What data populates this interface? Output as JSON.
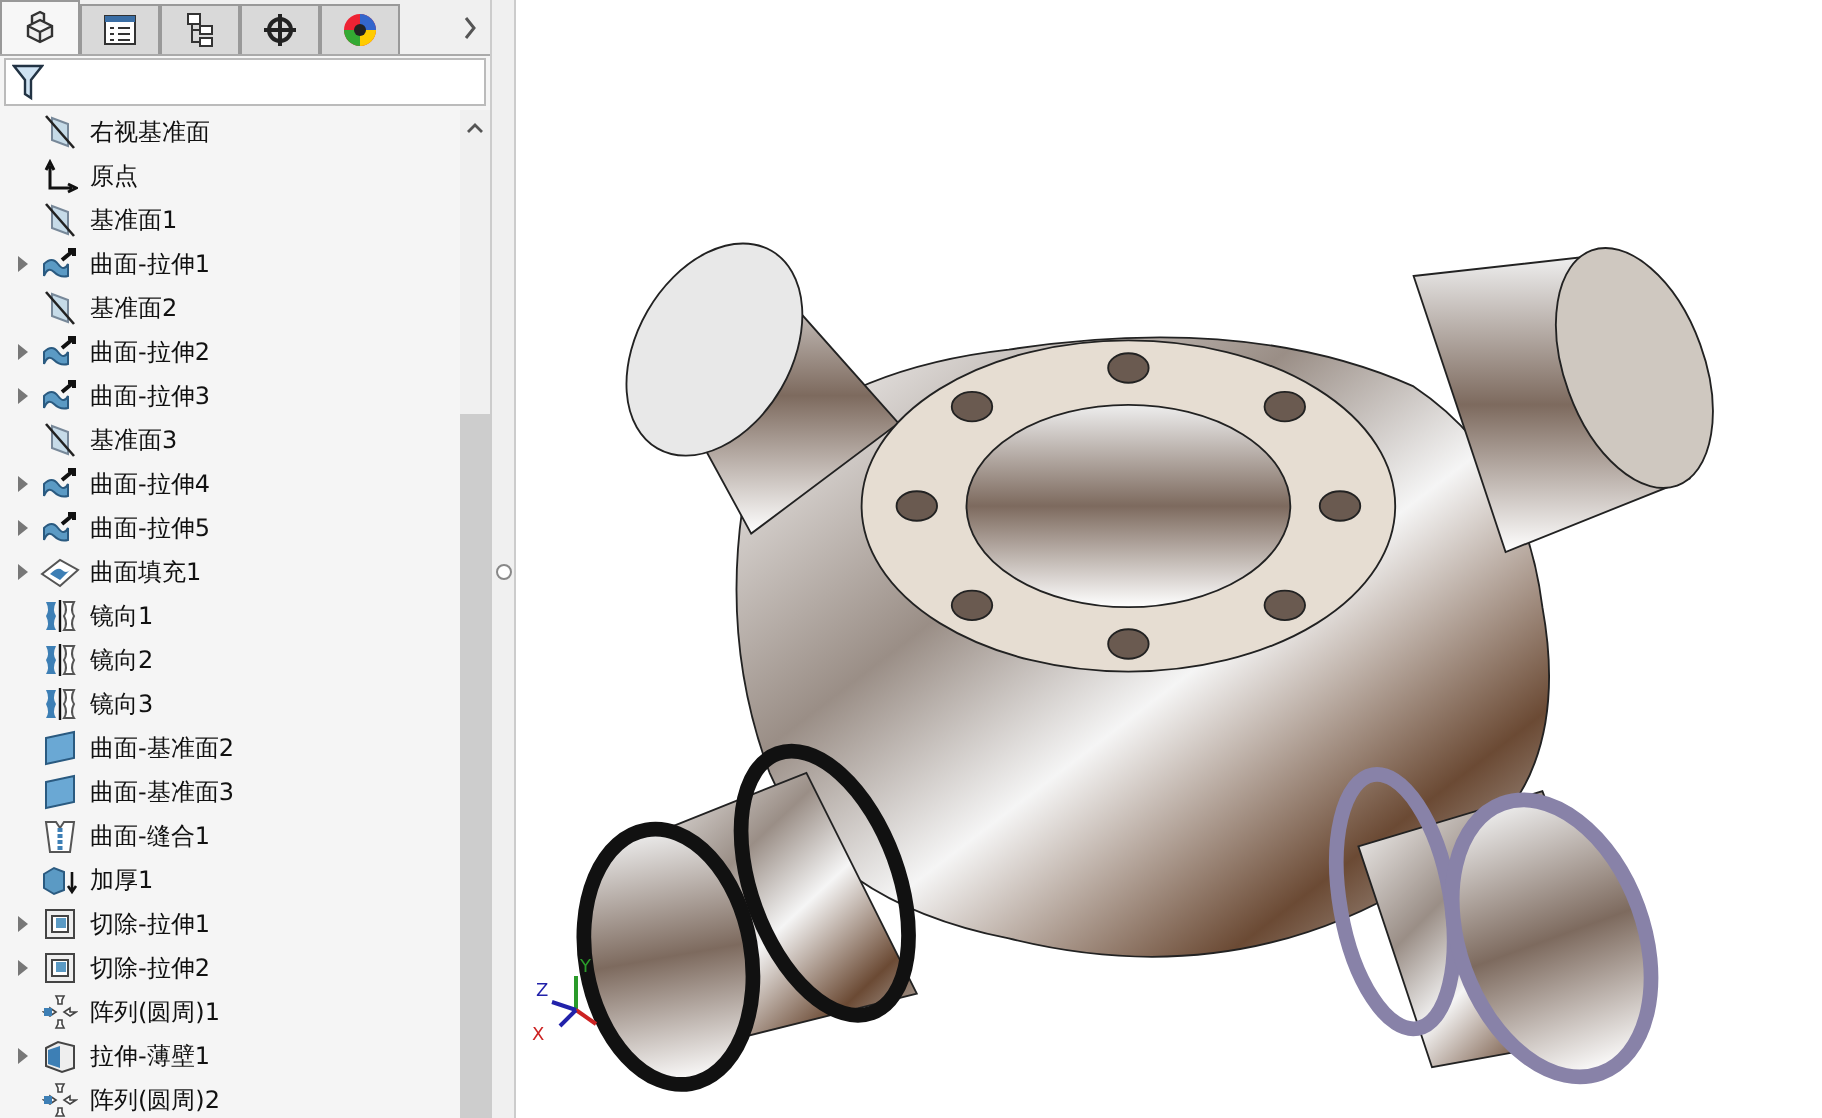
{
  "tabs": [
    {
      "kind": "part",
      "selected": true
    },
    {
      "kind": "property",
      "selected": false
    },
    {
      "kind": "config",
      "selected": false
    },
    {
      "kind": "dimxpert",
      "selected": false
    },
    {
      "kind": "display",
      "selected": false
    }
  ],
  "tree": {
    "items": [
      {
        "label": "右视基准面",
        "kind": "plane",
        "expandable": false
      },
      {
        "label": "原点",
        "kind": "origin",
        "expandable": false
      },
      {
        "label": "基准面1",
        "kind": "plane",
        "expandable": false
      },
      {
        "label": "曲面-拉伸1",
        "kind": "surface-extrude",
        "expandable": true
      },
      {
        "label": "基准面2",
        "kind": "plane",
        "expandable": false
      },
      {
        "label": "曲面-拉伸2",
        "kind": "surface-extrude",
        "expandable": true
      },
      {
        "label": "曲面-拉伸3",
        "kind": "surface-extrude",
        "expandable": true
      },
      {
        "label": "基准面3",
        "kind": "plane",
        "expandable": false
      },
      {
        "label": "曲面-拉伸4",
        "kind": "surface-extrude",
        "expandable": true
      },
      {
        "label": "曲面-拉伸5",
        "kind": "surface-extrude",
        "expandable": true
      },
      {
        "label": "曲面填充1",
        "kind": "fill",
        "expandable": true
      },
      {
        "label": "镜向1",
        "kind": "mirror",
        "expandable": false
      },
      {
        "label": "镜向2",
        "kind": "mirror",
        "expandable": false
      },
      {
        "label": "镜向3",
        "kind": "mirror",
        "expandable": false
      },
      {
        "label": "曲面-基准面2",
        "kind": "planar",
        "expandable": false
      },
      {
        "label": "曲面-基准面3",
        "kind": "planar",
        "expandable": false
      },
      {
        "label": "曲面-缝合1",
        "kind": "knit",
        "expandable": false
      },
      {
        "label": "加厚1",
        "kind": "thicken",
        "expandable": false
      },
      {
        "label": "切除-拉伸1",
        "kind": "cut",
        "expandable": true
      },
      {
        "label": "切除-拉伸2",
        "kind": "cut",
        "expandable": true
      },
      {
        "label": "阵列(圆周)1",
        "kind": "pattern",
        "expandable": false
      },
      {
        "label": "拉伸-薄壁1",
        "kind": "thin",
        "expandable": true
      },
      {
        "label": "阵列(圆周)2",
        "kind": "pattern",
        "expandable": false
      }
    ]
  },
  "triad": {
    "z": "Z",
    "y": "Y",
    "x": "X"
  }
}
